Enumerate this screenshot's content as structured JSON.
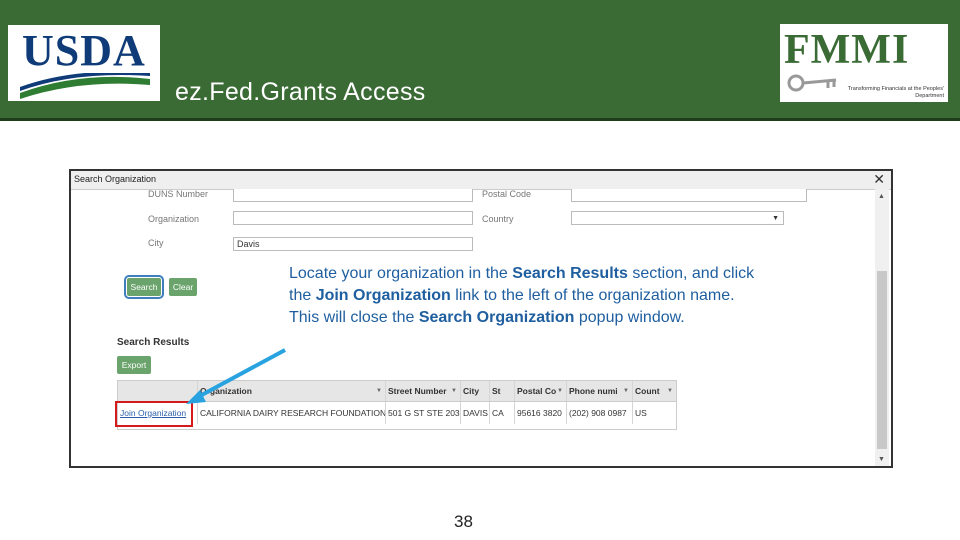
{
  "header": {
    "logo_left_text": "USDA",
    "logo_right_text": "FMMI",
    "logo_right_tagline": "Transforming Financials at the Peoples' Department",
    "slide_title": "ez.Fed.Grants Access"
  },
  "dialog": {
    "title": "Search Organization",
    "close_glyph": "✕",
    "fields": {
      "duns_label": "DUNS Number",
      "postal_label": "Postal Code",
      "org_label": "Organization",
      "org_value": "",
      "country_label": "Country",
      "country_value": "",
      "city_label": "City",
      "city_value": "Davis"
    },
    "buttons": {
      "search": "Search",
      "clear": "Clear",
      "export": "Export"
    },
    "results_title": "Search Results",
    "grid": {
      "columns": [
        "",
        "Organization",
        "Street Number",
        "City",
        "St",
        "Postal Co",
        "Phone numi",
        "Count"
      ],
      "row": {
        "link": "Join Organization",
        "organization": "CALIFORNIA DAIRY RESEARCH FOUNDATION N",
        "street": "501 G ST STE 203",
        "city": "DAVIS",
        "state": "CA",
        "postal": "95616 3820",
        "phone": "(202) 908 0987",
        "country": "US"
      }
    }
  },
  "callout": {
    "p1": "Locate your organization in the ",
    "b1": "Search Results",
    "p2": " section, and click the ",
    "b2": "Join Organization",
    "p3": " link to the left of the organization name. This will close the ",
    "b3": "Search Organization",
    "p4": " popup window."
  },
  "page_number": "38",
  "colors": {
    "header_green": "#3a6b35",
    "button_green": "#6aa36b",
    "callout_blue": "#1f5fa0",
    "arrow_blue": "#29a3e0",
    "highlight_red": "#d41a1a"
  }
}
